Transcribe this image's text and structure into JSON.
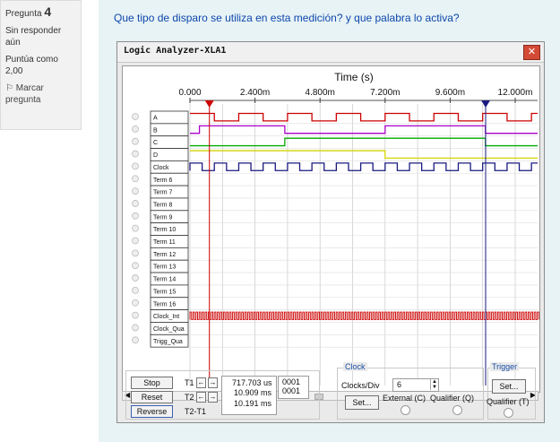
{
  "sidebar": {
    "question_label": "Pregunta",
    "question_number": "4",
    "status": "Sin responder aún",
    "score": "Puntúa como 2,00",
    "flag_label": "Marcar pregunta"
  },
  "question": {
    "text": "Que tipo de disparo se utiliza en esta medición? y que palabra lo activa?"
  },
  "window": {
    "title": "Logic Analyzer-XLA1",
    "close_symbol": "✕"
  },
  "analyzer": {
    "time_title": "Time (s)",
    "ticks": [
      "0.000",
      "2.400m",
      "4.800m",
      "7.200m",
      "9.600m",
      "12.000m"
    ],
    "channels": [
      "A",
      "B",
      "C",
      "D",
      "Clock",
      "Term 6",
      "Term 7",
      "Term 8",
      "Term 9",
      "Term 10",
      "Term 11",
      "Term 12",
      "Term 13",
      "Term 14",
      "Term 15",
      "Term 16"
    ],
    "aux_channels": [
      "Clock_Int",
      "Clock_Qua",
      "Trigg_Qua"
    ],
    "colors": {
      "A": "#cc0000",
      "B": "#aa00cc",
      "C": "#00aa00",
      "D": "#d4d400",
      "Clock": "#1a1a80",
      "Clock_Int": "#cc0000",
      "cursor1": "#cc0000",
      "cursor2": "#1a1a80"
    }
  },
  "controls": {
    "stop": "Stop",
    "reset": "Reset",
    "reverse": "Reverse",
    "t1": "T1",
    "t2": "T2",
    "t2t1": "T2-T1",
    "t1_value": "717.703 us",
    "t2_value": "10.909 ms",
    "dt_value": "10.191 ms",
    "t1_word": "0001",
    "t2_word": "0001",
    "clock_group": "Clock",
    "clocks_div_label": "Clocks/Div",
    "clocks_div_value": "6",
    "set_label": "Set...",
    "external_label": "External (C)",
    "qualifier_label": "Qualifier (Q)",
    "trigger_group": "Trigger",
    "trigger_set_label": "Set...",
    "trigger_qualifier_label": "Qualifier (T)"
  }
}
